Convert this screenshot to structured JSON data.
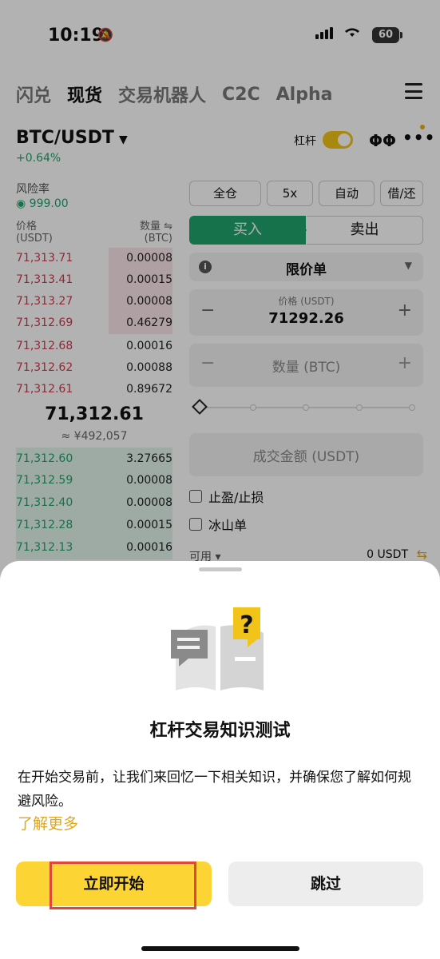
{
  "status": {
    "time": "10:19",
    "battery": "60"
  },
  "top_tabs": [
    "闪兑",
    "现货",
    "交易机器人",
    "C2C",
    "Alpha"
  ],
  "active_tab": "现货",
  "pair": {
    "name": "BTC/USDT",
    "change": "+0.64%",
    "leverage_label": "杠杆"
  },
  "risk": {
    "label": "风险率",
    "value": "999.00"
  },
  "orderbook": {
    "price_label": "价格",
    "price_unit": "(USDT)",
    "qty_label": "数量 ⇋",
    "qty_unit": "(BTC)",
    "asks": [
      {
        "price": "71,313.71",
        "qty": "0.00008"
      },
      {
        "price": "71,313.41",
        "qty": "0.00015"
      },
      {
        "price": "71,313.27",
        "qty": "0.00008"
      },
      {
        "price": "71,312.69",
        "qty": "0.46279"
      },
      {
        "price": "71,312.68",
        "qty": "0.00016"
      },
      {
        "price": "71,312.62",
        "qty": "0.00088"
      },
      {
        "price": "71,312.61",
        "qty": "0.89672"
      }
    ],
    "mid_price": "71,312.61",
    "mid_fiat": "≈ ¥492,057",
    "bids": [
      {
        "price": "71,312.60",
        "qty": "3.27665"
      },
      {
        "price": "71,312.59",
        "qty": "0.00008"
      },
      {
        "price": "71,312.40",
        "qty": "0.00008"
      },
      {
        "price": "71,312.28",
        "qty": "0.00015"
      },
      {
        "price": "71,312.13",
        "qty": "0.00016"
      }
    ]
  },
  "form": {
    "margin_mode": "全仓",
    "leverage": "5x",
    "auto": "自动",
    "borrow": "借/还",
    "buy": "买入",
    "sell": "卖出",
    "order_type": "限价单",
    "price_label": "价格 (USDT)",
    "price_value": "71292.26",
    "qty_placeholder": "数量 (BTC)",
    "total_placeholder": "成交金额 (USDT)",
    "tp_sl": "止盈/止损",
    "iceberg": "冰山单",
    "available_label": "可用 ▾",
    "available_value": "0 USDT"
  },
  "sheet": {
    "title": "杠杆交易知识测试",
    "description": "在开始交易前，让我们来回忆一下相关知识，并确保您了解如何规避风险。",
    "learn_more": "了解更多",
    "start": "立即开始",
    "skip": "跳过"
  }
}
